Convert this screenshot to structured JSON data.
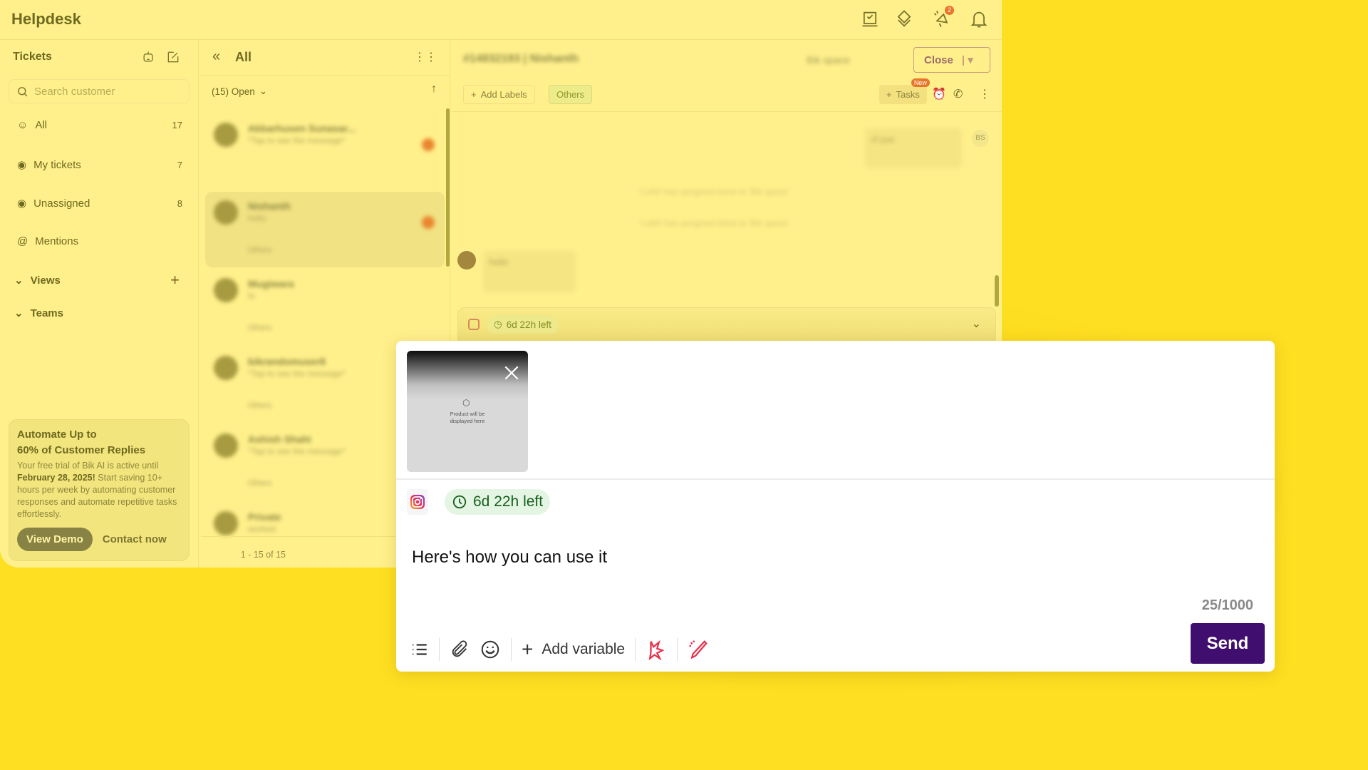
{
  "app": {
    "title": "Helpdesk",
    "notification_count": "2"
  },
  "sidebar": {
    "title": "Tickets",
    "search_placeholder": "Search customer",
    "items": [
      {
        "label": "All",
        "count": "17"
      },
      {
        "label": "My tickets",
        "count": "7"
      },
      {
        "label": "Unassigned",
        "count": "8"
      },
      {
        "label": "Mentions",
        "count": ""
      }
    ],
    "views": "Views",
    "teams": "Teams",
    "promo": {
      "title1": "Automate Up to",
      "title2": "60% of Customer Replies",
      "text1": "Your free trial of Bik AI is active until ",
      "date": "February 28, 2025!",
      "text2": " Start saving 10+ hours per week by automating customer responses and automate repetitive tasks effortlessly.",
      "view_demo": "View Demo",
      "contact": "Contact now"
    }
  },
  "list": {
    "title": "All",
    "filter": "(15) Open",
    "pagination": "1 - 15 of 15",
    "tickets": [
      {
        "name": "Akbarhusen Sunasar...",
        "message": "*Tap to see the message*",
        "tag": ""
      },
      {
        "name": "Nishanth",
        "message": "hello",
        "tag": "Others"
      },
      {
        "name": "Mugiwara",
        "message": "hi",
        "tag": "Others"
      },
      {
        "name": "bikrandomuser8",
        "message": "*Tap to see the message*",
        "tag": "Others"
      },
      {
        "name": "Ashish Shahi",
        "message": "*Tap to see the message*",
        "tag": "Others"
      },
      {
        "name": "Private",
        "message": "worked",
        "tag": ""
      }
    ]
  },
  "conversation": {
    "title": "#14832193 | Nishanth",
    "assignee": "Bik space",
    "close": "Close",
    "add_labels": "Add Labels",
    "label": "Others",
    "tasks": "Tasks",
    "new_badge": "New",
    "messages": [
      {
        "text": "vf jow",
        "avatar": "BS"
      },
      {
        "text": "hello"
      }
    ],
    "system": [
      "'Lohit' has assigned ticket to 'Bik space'",
      "'Lohit' has assigned ticket to 'Bik space'"
    ],
    "time_left": "6d 22h left"
  },
  "composer": {
    "product_placeholder1": "Product will be",
    "product_placeholder2": "displayed here",
    "time_left": "6d 22h left",
    "text": "Here's how you can use it",
    "counter": "25/1000",
    "add_variable": "Add variable",
    "send": "Send",
    "accent": "#3F0E6F",
    "channel": "instagram"
  }
}
